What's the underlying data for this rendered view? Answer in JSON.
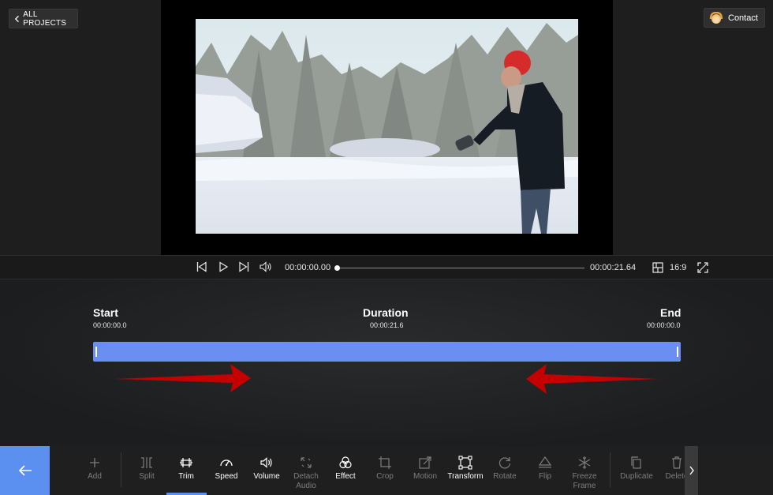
{
  "header": {
    "all_projects_label": "ALL PROJECTS",
    "contact_label": "Contact"
  },
  "player": {
    "current_time": "00:00:00.00",
    "total_time": "00:00:21.64",
    "aspect_ratio": "16:9",
    "progress": 0
  },
  "trim": {
    "start_label": "Start",
    "start_time": "00:00:00.0",
    "duration_label": "Duration",
    "duration_time": "00:00:21.6",
    "end_label": "End",
    "end_time": "00:00:00.0"
  },
  "toolbar": {
    "tools": [
      {
        "label": "Add",
        "icon": "plus-icon",
        "enabled": false
      },
      {
        "label": "Split",
        "icon": "split-icon",
        "enabled": false
      },
      {
        "label": "Trim",
        "icon": "trim-icon",
        "enabled": true,
        "active": true
      },
      {
        "label": "Speed",
        "icon": "speed-icon",
        "enabled": true
      },
      {
        "label": "Volume",
        "icon": "volume-icon",
        "enabled": true
      },
      {
        "label": "Detach Audio",
        "icon": "detach-audio-icon",
        "enabled": false
      },
      {
        "label": "Effect",
        "icon": "effect-icon",
        "enabled": true
      },
      {
        "label": "Crop",
        "icon": "crop-icon",
        "enabled": false
      },
      {
        "label": "Motion",
        "icon": "motion-icon",
        "enabled": false
      },
      {
        "label": "Transform",
        "icon": "transform-icon",
        "enabled": true
      },
      {
        "label": "Rotate",
        "icon": "rotate-icon",
        "enabled": false
      },
      {
        "label": "Flip",
        "icon": "flip-icon",
        "enabled": false
      },
      {
        "label": "Freeze Frame",
        "icon": "freeze-frame-icon",
        "enabled": false
      },
      {
        "label": "Duplicate",
        "icon": "duplicate-icon",
        "enabled": false
      },
      {
        "label": "Delete",
        "icon": "delete-icon",
        "enabled": false
      }
    ]
  },
  "colors": {
    "accent": "#5b8ff0",
    "trim_bar": "#6b8ef2",
    "arrow": "#d40000",
    "background": "#1e1e1e"
  }
}
